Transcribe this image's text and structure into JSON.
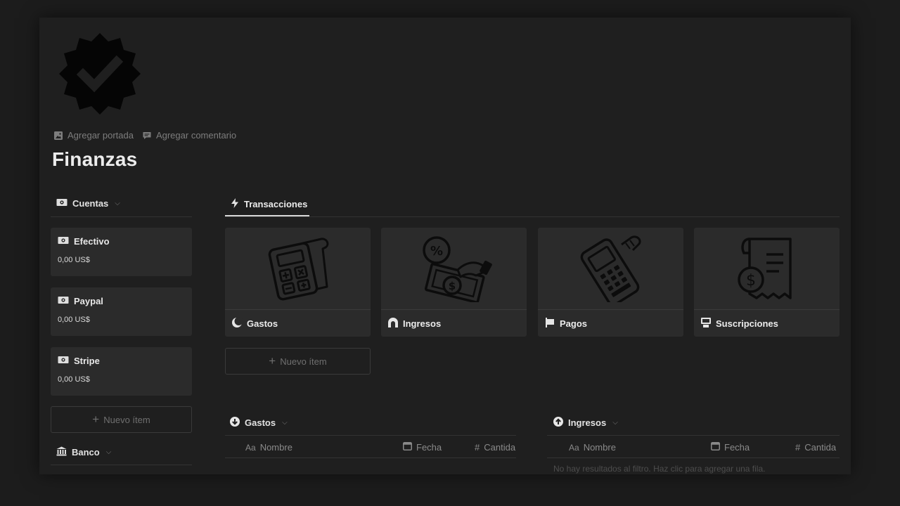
{
  "page": {
    "icon": "verified-badge-icon",
    "title": "Finanzas",
    "actions": {
      "cover": "Agregar portada",
      "comment": "Agregar comentario"
    }
  },
  "accounts": {
    "heading": "Cuentas",
    "items": [
      {
        "name": "Efectivo",
        "balance": "0,00 US$"
      },
      {
        "name": "Paypal",
        "balance": "0,00 US$"
      },
      {
        "name": "Stripe",
        "balance": "0,00 US$"
      }
    ],
    "new_item": "Nuevo ítem"
  },
  "bank": {
    "heading": "Banco"
  },
  "transactions": {
    "tab": "Transacciones",
    "cards": [
      {
        "name": "Gastos",
        "illustration": "calculator-receipt-illustration",
        "icon": "moon-icon"
      },
      {
        "name": "Ingresos",
        "illustration": "money-percent-illustration",
        "icon": "arch-icon"
      },
      {
        "name": "Pagos",
        "illustration": "pos-terminal-illustration",
        "icon": "flag-icon"
      },
      {
        "name": "Suscripciones",
        "illustration": "dollar-receipt-illustration",
        "icon": "computer-icon"
      }
    ],
    "new_item": "Nuevo ítem"
  },
  "expenses_db": {
    "heading": "Gastos",
    "columns": {
      "name": "Nombre",
      "date": "Fecha",
      "amount": "Cantida"
    }
  },
  "income_db": {
    "heading": "Ingresos",
    "columns": {
      "name": "Nombre",
      "date": "Fecha",
      "amount": "Cantida"
    },
    "empty": "No hay resultados al filtro. Haz clic para agregar una fila."
  },
  "colors": {
    "background": "#1c1c1c",
    "page": "#1f1f1f",
    "card": "#2b2b2b",
    "text": "#e6e6e6",
    "muted": "#7d7d7d"
  }
}
